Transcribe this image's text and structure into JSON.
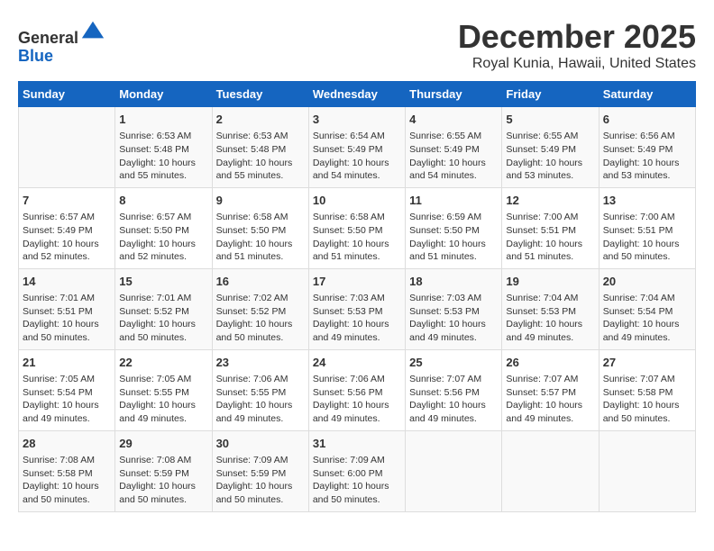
{
  "header": {
    "logo_line1": "General",
    "logo_line2": "Blue",
    "title": "December 2025",
    "subtitle": "Royal Kunia, Hawaii, United States"
  },
  "calendar": {
    "days_of_week": [
      "Sunday",
      "Monday",
      "Tuesday",
      "Wednesday",
      "Thursday",
      "Friday",
      "Saturday"
    ],
    "weeks": [
      [
        {
          "day": "",
          "info": ""
        },
        {
          "day": "1",
          "info": "Sunrise: 6:53 AM\nSunset: 5:48 PM\nDaylight: 10 hours\nand 55 minutes."
        },
        {
          "day": "2",
          "info": "Sunrise: 6:53 AM\nSunset: 5:48 PM\nDaylight: 10 hours\nand 55 minutes."
        },
        {
          "day": "3",
          "info": "Sunrise: 6:54 AM\nSunset: 5:49 PM\nDaylight: 10 hours\nand 54 minutes."
        },
        {
          "day": "4",
          "info": "Sunrise: 6:55 AM\nSunset: 5:49 PM\nDaylight: 10 hours\nand 54 minutes."
        },
        {
          "day": "5",
          "info": "Sunrise: 6:55 AM\nSunset: 5:49 PM\nDaylight: 10 hours\nand 53 minutes."
        },
        {
          "day": "6",
          "info": "Sunrise: 6:56 AM\nSunset: 5:49 PM\nDaylight: 10 hours\nand 53 minutes."
        }
      ],
      [
        {
          "day": "7",
          "info": "Sunrise: 6:57 AM\nSunset: 5:49 PM\nDaylight: 10 hours\nand 52 minutes."
        },
        {
          "day": "8",
          "info": "Sunrise: 6:57 AM\nSunset: 5:50 PM\nDaylight: 10 hours\nand 52 minutes."
        },
        {
          "day": "9",
          "info": "Sunrise: 6:58 AM\nSunset: 5:50 PM\nDaylight: 10 hours\nand 51 minutes."
        },
        {
          "day": "10",
          "info": "Sunrise: 6:58 AM\nSunset: 5:50 PM\nDaylight: 10 hours\nand 51 minutes."
        },
        {
          "day": "11",
          "info": "Sunrise: 6:59 AM\nSunset: 5:50 PM\nDaylight: 10 hours\nand 51 minutes."
        },
        {
          "day": "12",
          "info": "Sunrise: 7:00 AM\nSunset: 5:51 PM\nDaylight: 10 hours\nand 51 minutes."
        },
        {
          "day": "13",
          "info": "Sunrise: 7:00 AM\nSunset: 5:51 PM\nDaylight: 10 hours\nand 50 minutes."
        }
      ],
      [
        {
          "day": "14",
          "info": "Sunrise: 7:01 AM\nSunset: 5:51 PM\nDaylight: 10 hours\nand 50 minutes."
        },
        {
          "day": "15",
          "info": "Sunrise: 7:01 AM\nSunset: 5:52 PM\nDaylight: 10 hours\nand 50 minutes."
        },
        {
          "day": "16",
          "info": "Sunrise: 7:02 AM\nSunset: 5:52 PM\nDaylight: 10 hours\nand 50 minutes."
        },
        {
          "day": "17",
          "info": "Sunrise: 7:03 AM\nSunset: 5:53 PM\nDaylight: 10 hours\nand 49 minutes."
        },
        {
          "day": "18",
          "info": "Sunrise: 7:03 AM\nSunset: 5:53 PM\nDaylight: 10 hours\nand 49 minutes."
        },
        {
          "day": "19",
          "info": "Sunrise: 7:04 AM\nSunset: 5:53 PM\nDaylight: 10 hours\nand 49 minutes."
        },
        {
          "day": "20",
          "info": "Sunrise: 7:04 AM\nSunset: 5:54 PM\nDaylight: 10 hours\nand 49 minutes."
        }
      ],
      [
        {
          "day": "21",
          "info": "Sunrise: 7:05 AM\nSunset: 5:54 PM\nDaylight: 10 hours\nand 49 minutes."
        },
        {
          "day": "22",
          "info": "Sunrise: 7:05 AM\nSunset: 5:55 PM\nDaylight: 10 hours\nand 49 minutes."
        },
        {
          "day": "23",
          "info": "Sunrise: 7:06 AM\nSunset: 5:55 PM\nDaylight: 10 hours\nand 49 minutes."
        },
        {
          "day": "24",
          "info": "Sunrise: 7:06 AM\nSunset: 5:56 PM\nDaylight: 10 hours\nand 49 minutes."
        },
        {
          "day": "25",
          "info": "Sunrise: 7:07 AM\nSunset: 5:56 PM\nDaylight: 10 hours\nand 49 minutes."
        },
        {
          "day": "26",
          "info": "Sunrise: 7:07 AM\nSunset: 5:57 PM\nDaylight: 10 hours\nand 49 minutes."
        },
        {
          "day": "27",
          "info": "Sunrise: 7:07 AM\nSunset: 5:58 PM\nDaylight: 10 hours\nand 50 minutes."
        }
      ],
      [
        {
          "day": "28",
          "info": "Sunrise: 7:08 AM\nSunset: 5:58 PM\nDaylight: 10 hours\nand 50 minutes."
        },
        {
          "day": "29",
          "info": "Sunrise: 7:08 AM\nSunset: 5:59 PM\nDaylight: 10 hours\nand 50 minutes."
        },
        {
          "day": "30",
          "info": "Sunrise: 7:09 AM\nSunset: 5:59 PM\nDaylight: 10 hours\nand 50 minutes."
        },
        {
          "day": "31",
          "info": "Sunrise: 7:09 AM\nSunset: 6:00 PM\nDaylight: 10 hours\nand 50 minutes."
        },
        {
          "day": "",
          "info": ""
        },
        {
          "day": "",
          "info": ""
        },
        {
          "day": "",
          "info": ""
        }
      ]
    ]
  }
}
